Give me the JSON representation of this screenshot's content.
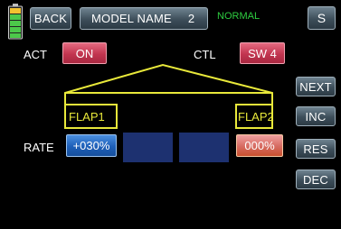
{
  "header": {
    "back_label": "BACK",
    "model_name": "MODEL NAME",
    "model_number": "2",
    "mode": "NORMAL",
    "s_button_label": "S"
  },
  "act": {
    "label": "ACT",
    "value": "ON"
  },
  "ctl": {
    "label": "CTL",
    "value": "SW 4"
  },
  "flaps": {
    "left_label": "FLAP1",
    "right_label": "FLAP2"
  },
  "rate": {
    "label": "RATE",
    "left_value": "+030%",
    "right_value": "000%"
  },
  "side_buttons": {
    "next": "NEXT",
    "inc": "INC",
    "res": "RES",
    "dec": "DEC"
  },
  "colors": {
    "accent_yellow": "#e8e83a",
    "mode_green": "#2ecc40",
    "on_red": "#c23550",
    "rate_blue": "#1e5fb8",
    "panel_dark_blue": "#1d3170"
  }
}
